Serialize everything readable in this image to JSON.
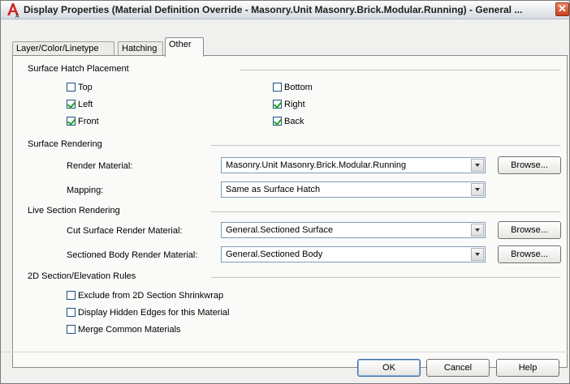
{
  "window": {
    "title": "Display Properties (Material Definition Override - Masonry.Unit Masonry.Brick.Modular.Running) - General ...",
    "app_icon": "autocad-architecture-icon",
    "close_icon": "close-icon"
  },
  "tabs": [
    {
      "label": "Layer/Color/Linetype",
      "active": false
    },
    {
      "label": "Hatching",
      "active": false
    },
    {
      "label": "Other",
      "active": true
    }
  ],
  "surface_hatch": {
    "heading": "Surface Hatch Placement",
    "top": {
      "label": "Top",
      "checked": false
    },
    "bottom": {
      "label": "Bottom",
      "checked": false
    },
    "left": {
      "label": "Left",
      "checked": true
    },
    "right": {
      "label": "Right",
      "checked": true
    },
    "front": {
      "label": "Front",
      "checked": true
    },
    "back": {
      "label": "Back",
      "checked": true
    }
  },
  "surface_rendering": {
    "heading": "Surface Rendering",
    "render_material_label": "Render Material:",
    "render_material_value": "Masonry.Unit Masonry.Brick.Modular.Running",
    "mapping_label": "Mapping:",
    "mapping_value": "Same as Surface Hatch",
    "browse_label": "Browse..."
  },
  "live_section": {
    "heading": "Live Section Rendering",
    "cut_surface_label": "Cut Surface Render Material:",
    "cut_surface_value": "General.Sectioned Surface",
    "sectioned_body_label": "Sectioned Body Render Material:",
    "sectioned_body_value": "General.Sectioned Body",
    "browse_label": "Browse..."
  },
  "section_rules": {
    "heading": "2D Section/Elevation Rules",
    "exclude": {
      "label": "Exclude from 2D Section Shrinkwrap",
      "checked": false
    },
    "hidden_edges": {
      "label": "Display Hidden Edges for this Material",
      "checked": false
    },
    "merge": {
      "label": "Merge Common Materials",
      "checked": false
    }
  },
  "buttons": {
    "ok": "OK",
    "cancel": "Cancel",
    "help": "Help"
  }
}
